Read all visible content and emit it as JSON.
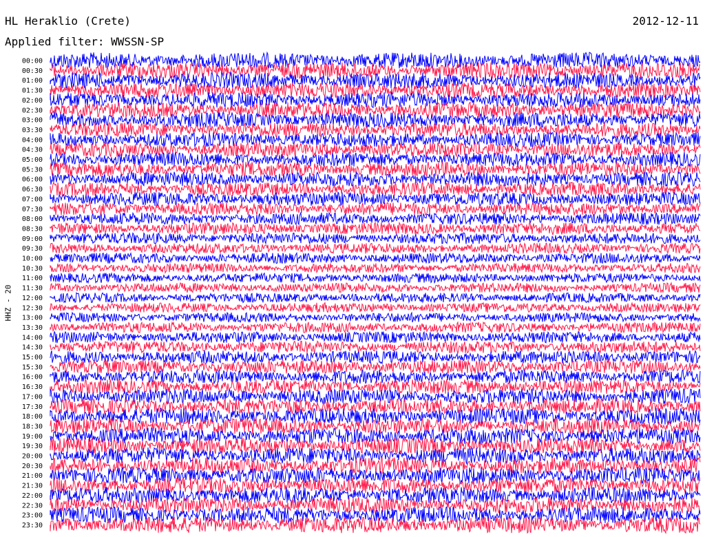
{
  "header": {
    "station": "HL Heraklio (Crete)",
    "date": "2012-12-11",
    "filter": "Applied filter: WWSSN-SP"
  },
  "chart_data": {
    "type": "line",
    "chart_kind": "helicorder seismogram",
    "channel_label": "HHZ - 20",
    "rows": [
      "00:00",
      "00:30",
      "01:00",
      "01:30",
      "02:00",
      "02:30",
      "03:00",
      "03:30",
      "04:00",
      "04:30",
      "05:00",
      "05:30",
      "06:00",
      "06:30",
      "07:00",
      "07:30",
      "08:00",
      "08:30",
      "09:00",
      "09:30",
      "10:00",
      "10:30",
      "11:00",
      "11:30",
      "12:00",
      "12:30",
      "13:00",
      "13:30",
      "14:00",
      "14:30",
      "15:00",
      "15:30",
      "16:00",
      "16:30",
      "17:00",
      "17:30",
      "18:00",
      "18:30",
      "19:00",
      "19:30",
      "20:00",
      "20:30",
      "21:00",
      "21:30",
      "22:00",
      "22:30",
      "23:00",
      "23:30"
    ],
    "row_duration_minutes": 30,
    "trace_colors": [
      "#0000ff",
      "#ff1a4a"
    ],
    "relative_amplitude": [
      1.0,
      1.0,
      1.0,
      0.95,
      0.95,
      0.95,
      0.95,
      0.9,
      0.9,
      0.9,
      0.9,
      0.9,
      0.9,
      0.85,
      0.85,
      0.8,
      0.75,
      0.75,
      0.7,
      0.65,
      0.65,
      0.6,
      0.6,
      0.6,
      0.6,
      0.6,
      0.6,
      0.65,
      0.7,
      0.75,
      0.8,
      0.85,
      0.85,
      0.9,
      0.95,
      0.95,
      1.0,
      1.0,
      1.0,
      1.0,
      1.0,
      1.0,
      1.0,
      1.0,
      1.0,
      1.0,
      1.0,
      1.0
    ],
    "grid": false
  }
}
